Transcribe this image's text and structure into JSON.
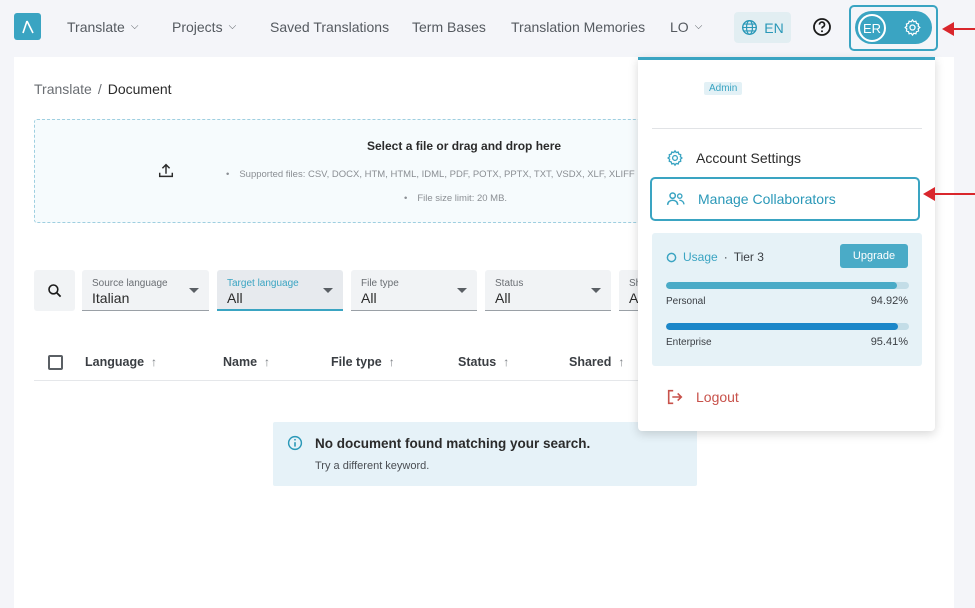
{
  "nav": {
    "items": [
      {
        "label": "Translate",
        "has_caret": true
      },
      {
        "label": "Projects",
        "has_caret": true
      },
      {
        "label": "Saved Translations",
        "has_caret": false
      },
      {
        "label": "Term Bases",
        "has_caret": false
      },
      {
        "label": "Translation Memories",
        "has_caret": false
      },
      {
        "label": "LO",
        "has_caret": true
      }
    ],
    "language": "EN",
    "user_initials": "ER"
  },
  "breadcrumb": {
    "parent": "Translate",
    "separator": "/",
    "current": "Document"
  },
  "dropzone": {
    "title": "Select a file or drag and drop here",
    "supported": "Supported files: CSV, DOCX, HTM, HTML, IDML, PDF, POTX, PPTX, TXT, VSDX, XLF, XLIFF",
    "size_limit": "File size limit: 20 MB."
  },
  "filters": [
    {
      "label": "Source language",
      "value": "Italian",
      "active": false
    },
    {
      "label": "Target language",
      "value": "All",
      "active": true
    },
    {
      "label": "File type",
      "value": "All",
      "active": false
    },
    {
      "label": "Status",
      "value": "All",
      "active": false
    },
    {
      "label": "Sh",
      "value": "A",
      "active": false
    }
  ],
  "table": {
    "columns": [
      "Language",
      "Name",
      "File type",
      "Status",
      "Shared"
    ],
    "sort_icon": "↑"
  },
  "empty_state": {
    "title": "No document found matching your search.",
    "subtitle": "Try a different keyword."
  },
  "user_menu": {
    "role_badge": "Admin",
    "account_settings": "Account Settings",
    "manage_collaborators": "Manage Collaborators",
    "usage": {
      "label": "Usage",
      "separator": "·",
      "tier": "Tier 3",
      "upgrade_label": "Upgrade",
      "bars": [
        {
          "name": "Personal",
          "percent_label": "94.92%",
          "fraction": 0.9492,
          "color": "#4aabc7"
        },
        {
          "name": "Enterprise",
          "percent_label": "95.41%",
          "fraction": 0.9541,
          "color": "#1b87c9"
        }
      ]
    },
    "logout": "Logout"
  },
  "colors": {
    "accent": "#3aa4c2",
    "annotation_arrow": "#d9262c",
    "logout": "#c8524b"
  }
}
